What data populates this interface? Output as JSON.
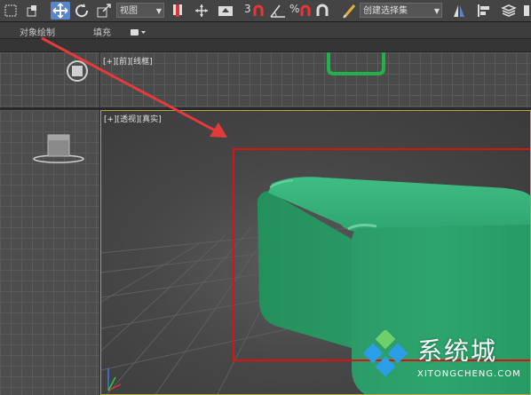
{
  "toolbar": {
    "view_dropdown": "视图",
    "num_3": "3",
    "percent": "%",
    "selection_set_dropdown": "创建选择集"
  },
  "ribbon": {
    "object_paint": "对象绘制",
    "populate": "填充"
  },
  "viewports": {
    "front": {
      "label": "[+][前][线框]"
    },
    "perspective": {
      "label": "[+][透视][真实]"
    }
  },
  "watermark": {
    "text": "系统城",
    "domain": "XITONGCHENG.COM"
  },
  "colors": {
    "box_green": "#2a9e6c",
    "highlight_red": "#e01010",
    "arrow_red": "#e53a3a",
    "viewport_border": "#b8a24a",
    "active_tool": "#5a85c8"
  }
}
